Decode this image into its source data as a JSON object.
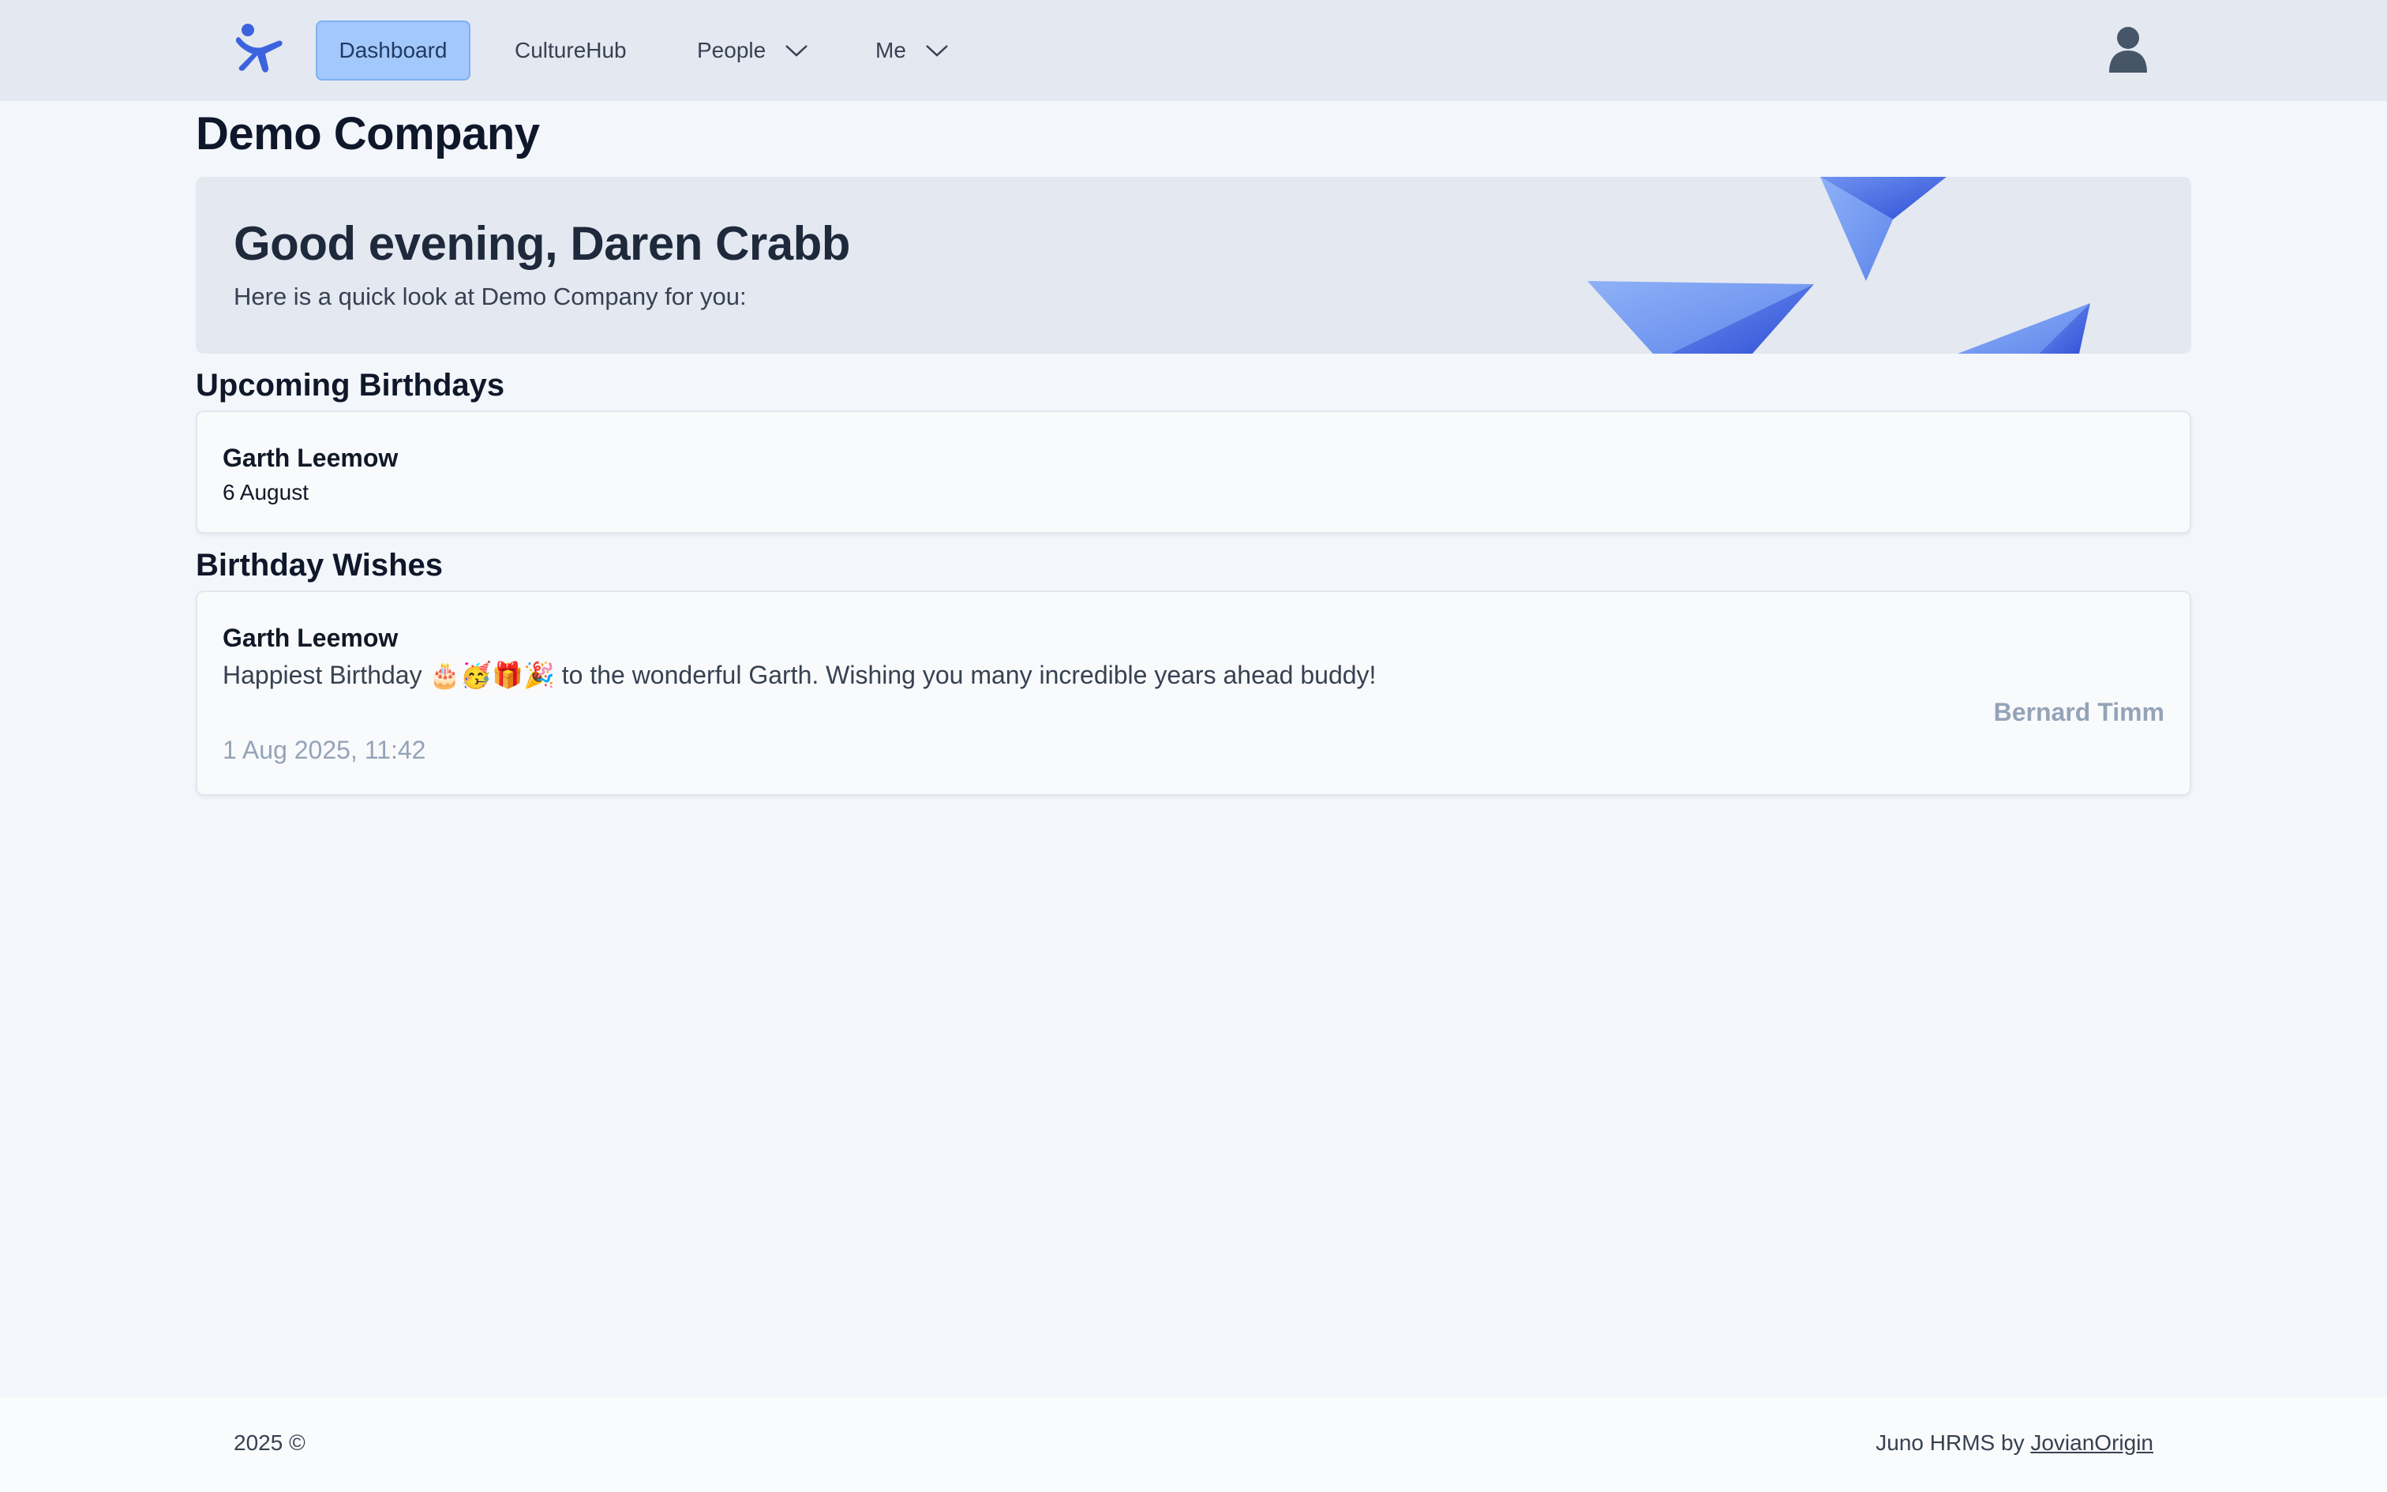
{
  "nav": {
    "logo_icon": "juno-logo-icon",
    "items": [
      {
        "label": "Dashboard",
        "active": true
      },
      {
        "label": "CultureHub",
        "active": false
      },
      {
        "label": "People",
        "active": false,
        "dropdown": true
      },
      {
        "label": "Me",
        "active": false,
        "dropdown": true
      }
    ],
    "user_icon": "user-avatar-icon"
  },
  "page": {
    "title": "Demo Company"
  },
  "hero": {
    "greeting": "Good evening, Daren Crabb",
    "subtitle": "Here is a quick look at Demo Company for you:"
  },
  "birthdays": {
    "heading": "Upcoming Birthdays",
    "items": [
      {
        "name": "Garth Leemow",
        "date": "6 August"
      }
    ]
  },
  "wishes": {
    "heading": "Birthday Wishes",
    "items": [
      {
        "recipient": "Garth Leemow",
        "message": "Happiest Birthday 🎂🥳🎁🎉 to the wonderful Garth. Wishing you many incredible years ahead buddy!",
        "author": "Bernard Timm",
        "timestamp": "1 Aug 2025, 11:42"
      }
    ]
  },
  "footer": {
    "copyright": "2025 ©",
    "credit_prefix": "Juno HRMS by ",
    "credit_link": "JovianOrigin"
  },
  "colors": {
    "accent": "#3b63dd",
    "active_tab_bg": "#a3c8fb",
    "nav_bg": "#e4e8f0",
    "page_bg": "#f3f6fa",
    "muted_text": "#94a3b8"
  }
}
